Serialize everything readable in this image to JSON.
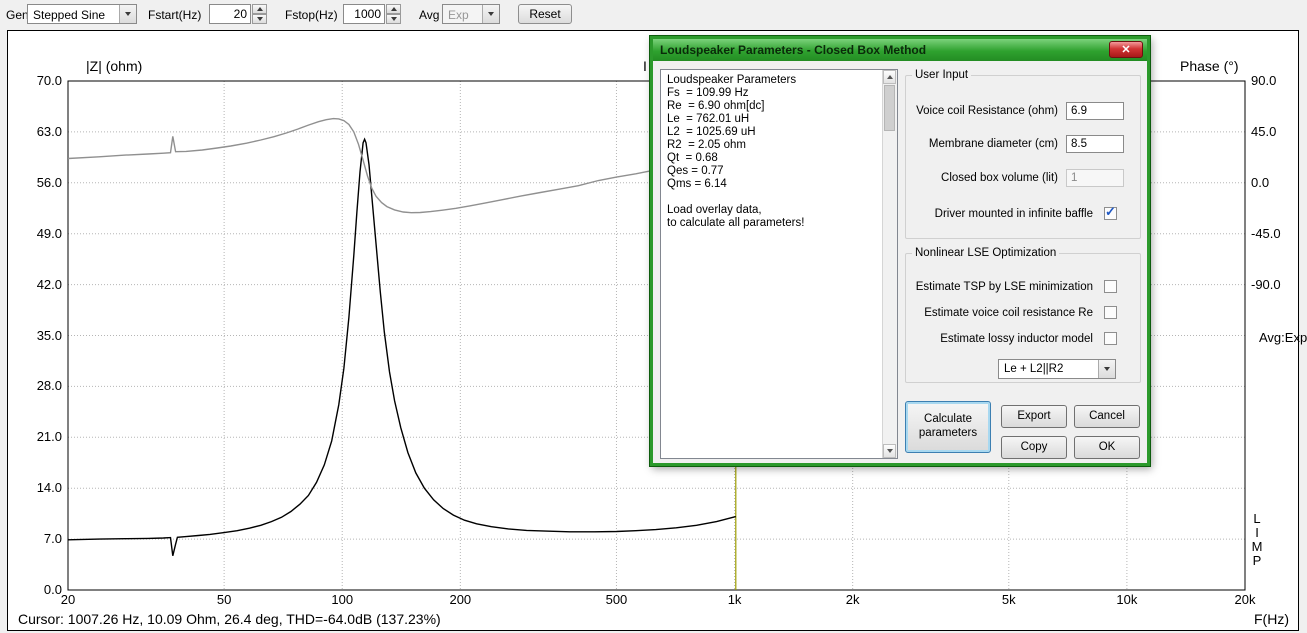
{
  "icons": {
    "close": "✕",
    "check": "✓"
  },
  "toolbar": {
    "gen_label": "Gen",
    "generator_value": "Stepped Sine",
    "fstart_label": "Fstart(Hz)",
    "fstart_value": "20",
    "fstop_label": "Fstop(Hz)",
    "fstop_value": "1000",
    "avg_label": "Avg",
    "avg_value": "Exp",
    "reset_label": "Reset"
  },
  "chart": {
    "title_fragment": "I",
    "y_left_title": "|Z| (ohm)",
    "y_right_title": "Phase (°)",
    "x_title": "F(Hz)",
    "avg_indicator": "Avg:Exp",
    "program_letters": [
      "L",
      "I",
      "M",
      "P"
    ],
    "status_line": "Cursor: 1007.26 Hz, 10.09 Ohm, 26.4 deg, THD=-64.0dB (137.23%)"
  },
  "chart_data": {
    "type": "line",
    "x_axis": {
      "label": "F(Hz)",
      "scale": "log",
      "min": 20,
      "max": 20000,
      "tick_labels": [
        "20",
        "50",
        "100",
        "200",
        "500",
        "1k",
        "2k",
        "5k",
        "10k",
        "20k"
      ],
      "tick_values": [
        20,
        50,
        100,
        200,
        500,
        1000,
        2000,
        5000,
        10000,
        20000
      ]
    },
    "y_left": {
      "label": "|Z| (ohm)",
      "min": 0,
      "max": 70,
      "tick_labels": [
        "70.0",
        "63.0",
        "56.0",
        "49.0",
        "42.0",
        "35.0",
        "28.0",
        "21.0",
        "14.0",
        "7.0",
        "0.0"
      ]
    },
    "y_right": {
      "label": "Phase (°)",
      "deg_per_division": 45,
      "tick_labels": [
        "90.0",
        "45.0",
        "0.0",
        "-45.0",
        "-90.0"
      ]
    },
    "cursor": {
      "frequency_hz": 1007.26,
      "impedance_ohm": 10.09,
      "phase_deg": 26.4,
      "thd_db": -64.0,
      "thd_pct": 137.23
    },
    "grid": true,
    "cursor_color": "#9c9c00",
    "series": [
      {
        "name": "impedance",
        "axis": "left",
        "color": "#000000",
        "points": [
          [
            20,
            6.9
          ],
          [
            24,
            7
          ],
          [
            28,
            7.05
          ],
          [
            32,
            7.1
          ],
          [
            35,
            7.15
          ],
          [
            36.5,
            7.2
          ],
          [
            37,
            4.7
          ],
          [
            37.6,
            6.3
          ],
          [
            38,
            7.25
          ],
          [
            40,
            7.35
          ],
          [
            43,
            7.5
          ],
          [
            46,
            7.65
          ],
          [
            50,
            7.9
          ],
          [
            54,
            8.15
          ],
          [
            58,
            8.5
          ],
          [
            62,
            8.9
          ],
          [
            66,
            9.4
          ],
          [
            70,
            10
          ],
          [
            74,
            10.8
          ],
          [
            78,
            11.8
          ],
          [
            82,
            13
          ],
          [
            86,
            14.8
          ],
          [
            90,
            17.2
          ],
          [
            94,
            20.5
          ],
          [
            98,
            25.5
          ],
          [
            101,
            30.5
          ],
          [
            104,
            37.5
          ],
          [
            107,
            46
          ],
          [
            109,
            52
          ],
          [
            111,
            57.5
          ],
          [
            113,
            61.5
          ],
          [
            114,
            62
          ],
          [
            115,
            61.5
          ],
          [
            117,
            58.5
          ],
          [
            119,
            54
          ],
          [
            122,
            47.5
          ],
          [
            125,
            41
          ],
          [
            128,
            35.5
          ],
          [
            132,
            30
          ],
          [
            136,
            26
          ],
          [
            141,
            22.3
          ],
          [
            147,
            18.9
          ],
          [
            154,
            16.1
          ],
          [
            162,
            14
          ],
          [
            171,
            12.4
          ],
          [
            181,
            11.2
          ],
          [
            192,
            10.3
          ],
          [
            205,
            9.6
          ],
          [
            220,
            9.1
          ],
          [
            240,
            8.7
          ],
          [
            265,
            8.4
          ],
          [
            295,
            8.2
          ],
          [
            330,
            8.1
          ],
          [
            380,
            8
          ],
          [
            440,
            8
          ],
          [
            500,
            8.05
          ],
          [
            560,
            8.15
          ],
          [
            630,
            8.3
          ],
          [
            710,
            8.55
          ],
          [
            800,
            8.9
          ],
          [
            900,
            9.4
          ],
          [
            1007,
            10.09
          ]
        ]
      },
      {
        "name": "phase",
        "axis": "right",
        "color": "#909090",
        "points": [
          [
            20,
            21.5
          ],
          [
            24,
            23
          ],
          [
            28,
            24.5
          ],
          [
            32,
            25.5
          ],
          [
            35,
            26.2
          ],
          [
            36.5,
            26.6
          ],
          [
            37,
            41
          ],
          [
            37.6,
            27.5
          ],
          [
            40,
            27.8
          ],
          [
            44,
            29
          ],
          [
            48,
            30.8
          ],
          [
            52,
            32.5
          ],
          [
            57,
            35
          ],
          [
            62,
            37.8
          ],
          [
            67,
            40.8
          ],
          [
            72,
            44
          ],
          [
            77,
            47.5
          ],
          [
            82,
            51
          ],
          [
            87,
            54
          ],
          [
            91,
            55.8
          ],
          [
            95,
            56.8
          ],
          [
            98,
            56.5
          ],
          [
            101,
            55
          ],
          [
            104,
            51.5
          ],
          [
            107,
            45
          ],
          [
            110,
            34
          ],
          [
            113,
            20
          ],
          [
            116,
            6
          ],
          [
            119,
            -5
          ],
          [
            122,
            -12
          ],
          [
            126,
            -17.5
          ],
          [
            130,
            -21
          ],
          [
            136,
            -24
          ],
          [
            143,
            -25.8
          ],
          [
            150,
            -26.4
          ],
          [
            158,
            -26.3
          ],
          [
            168,
            -25.5
          ],
          [
            180,
            -24.2
          ],
          [
            195,
            -22.5
          ],
          [
            212,
            -20.3
          ],
          [
            232,
            -17.8
          ],
          [
            255,
            -15
          ],
          [
            285,
            -11.8
          ],
          [
            320,
            -8.6
          ],
          [
            360,
            -5.4
          ],
          [
            400,
            -2.6
          ],
          [
            450,
            2
          ],
          [
            500,
            5
          ],
          [
            560,
            8
          ],
          [
            630,
            11.5
          ],
          [
            710,
            15
          ],
          [
            800,
            18.5
          ],
          [
            900,
            22.3
          ],
          [
            1007,
            26.4
          ]
        ]
      }
    ]
  },
  "dialog": {
    "title": "Loudspeaker Parameters - Closed Box Method",
    "results_lines": [
      "Loudspeaker Parameters",
      "Fs  = 109.99 Hz",
      "Re  = 6.90 ohm[dc]",
      "Le  = 762.01 uH",
      "L2  = 1025.69 uH",
      "R2  = 2.05 ohm",
      "Qt  = 0.68",
      "Qes = 0.77",
      "Qms = 6.14",
      "",
      "Load overlay data,",
      "to calculate all parameters!"
    ],
    "user_input": {
      "group_label": "User Input",
      "fields": [
        {
          "label": "Voice coil Resistance (ohm)",
          "value": "6.9"
        },
        {
          "label": "Membrane diameter (cm)",
          "value": "8.5"
        },
        {
          "label": "Closed box volume (lit)",
          "value": "1"
        }
      ],
      "baffle_checkbox_label": "Driver mounted in infinite baffle",
      "baffle_checked": true
    },
    "lse": {
      "group_label": "Nonlinear LSE Optimization",
      "options": [
        {
          "label": "Estimate TSP by LSE minimization",
          "checked": false
        },
        {
          "label": "Estimate voice coil resistance Re",
          "checked": false
        },
        {
          "label": "Estimate lossy inductor model",
          "checked": false
        }
      ],
      "inductor_model_value": "Le + L2||R2"
    },
    "buttons": {
      "calculate": "Calculate parameters",
      "export": "Export",
      "cancel": "Cancel",
      "copy": "Copy",
      "ok": "OK"
    }
  }
}
